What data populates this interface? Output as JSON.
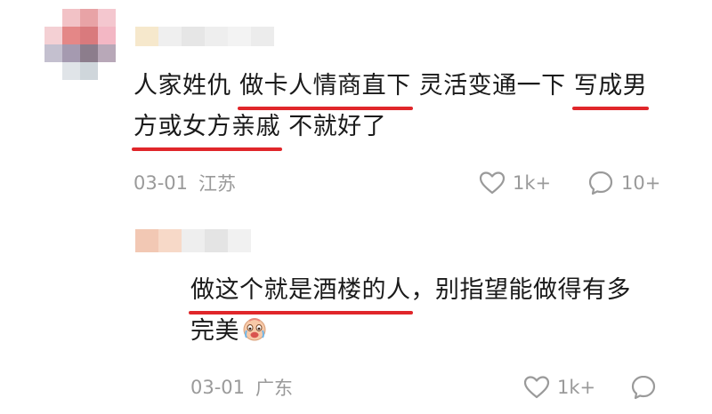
{
  "comments": [
    {
      "text_parts": {
        "p1": "人家姓仇 ",
        "p2": "做卡人情商直下",
        "p3": " 灵活变通一下 ",
        "p4": "写成男",
        "p5": "方或女方亲戚",
        "p6": " 不就好了"
      },
      "date": "03-01",
      "location": "江苏",
      "likes": "1k+",
      "replies": "10+"
    },
    {
      "text_parts": {
        "p1": "做这个就是酒楼的人",
        "p2": "，别指望能做得有多",
        "p3": "完美"
      },
      "emoji": "crying-face-emoji",
      "date": "03-01",
      "location": "广东",
      "likes": "1k+"
    }
  ],
  "icons": {
    "like": "heart-icon",
    "reply": "comment-bubble-icon"
  },
  "colors": {
    "underline": "#e0262a",
    "text": "#1a1a1a",
    "meta": "#9a9a9a"
  }
}
